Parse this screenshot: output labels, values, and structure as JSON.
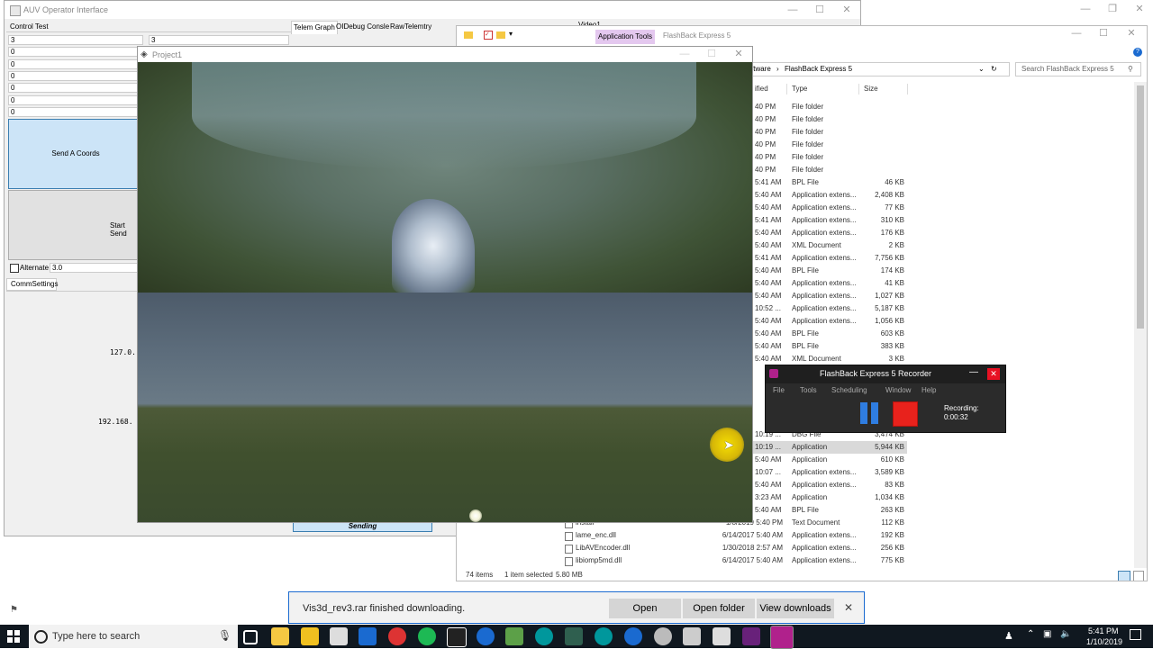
{
  "auv": {
    "title": "AUV Operator Interface",
    "control_test_label": "Control Test",
    "fields": [
      "3",
      "0",
      "0",
      "0",
      "0",
      "0",
      "0",
      "0"
    ],
    "field_right": "3",
    "send_coords_label": "Send A Coords",
    "start_send_label": "Start Send",
    "alternate_label": "Alternate",
    "alternate_value": "3.0",
    "comm_tab": "CommSettings",
    "ip1": "127.0.",
    "ip2": "192.168.",
    "tabs": [
      "Telem Graph",
      "OIDebug Consle",
      "RawTelemtry"
    ],
    "video_tab": "Video1",
    "sending_label": "Sending"
  },
  "project": {
    "title": "Project1"
  },
  "explorer": {
    "ribbon_context": "Application Tools",
    "title": "FlashBack Express 5",
    "path_prefix": "ftware",
    "path_current": "FlashBack Express 5",
    "search_placeholder": "Search FlashBack Express 5",
    "headers": {
      "modified": "ified",
      "type": "Type",
      "size": "Size"
    },
    "rows": [
      {
        "m": "40 PM",
        "t": "File folder",
        "s": ""
      },
      {
        "m": "40 PM",
        "t": "File folder",
        "s": ""
      },
      {
        "m": "40 PM",
        "t": "File folder",
        "s": ""
      },
      {
        "m": "40 PM",
        "t": "File folder",
        "s": ""
      },
      {
        "m": "40 PM",
        "t": "File folder",
        "s": ""
      },
      {
        "m": "40 PM",
        "t": "File folder",
        "s": ""
      },
      {
        "m": "5:41 AM",
        "t": "BPL File",
        "s": "46 KB"
      },
      {
        "m": "5:40 AM",
        "t": "Application extens...",
        "s": "2,408 KB"
      },
      {
        "m": "5:40 AM",
        "t": "Application extens...",
        "s": "77 KB"
      },
      {
        "m": "5:41 AM",
        "t": "Application extens...",
        "s": "310 KB"
      },
      {
        "m": "5:40 AM",
        "t": "Application extens...",
        "s": "176 KB"
      },
      {
        "m": "5:40 AM",
        "t": "XML Document",
        "s": "2 KB"
      },
      {
        "m": "5:41 AM",
        "t": "Application extens...",
        "s": "7,756 KB"
      },
      {
        "m": "5:40 AM",
        "t": "BPL File",
        "s": "174 KB"
      },
      {
        "m": "5:40 AM",
        "t": "Application extens...",
        "s": "41 KB"
      },
      {
        "m": "5:40 AM",
        "t": "Application extens...",
        "s": "1,027 KB"
      },
      {
        "m": "10:52 ...",
        "t": "Application extens...",
        "s": "5,187 KB"
      },
      {
        "m": "5:40 AM",
        "t": "Application extens...",
        "s": "1,056 KB"
      },
      {
        "m": "5:40 AM",
        "t": "BPL File",
        "s": "603 KB"
      },
      {
        "m": "5:40 AM",
        "t": "BPL File",
        "s": "383 KB"
      },
      {
        "m": "5:40 AM",
        "t": "XML Document",
        "s": "3 KB"
      }
    ],
    "lower_rows": [
      {
        "n": "",
        "m": "10:19 ...",
        "t": "DBG File",
        "s": "3,474 KB",
        "sel": false
      },
      {
        "n": "",
        "m": "10:19 ...",
        "t": "Application",
        "s": "5,944 KB",
        "sel": true
      },
      {
        "n": "",
        "m": "5:40 AM",
        "t": "Application",
        "s": "610 KB",
        "sel": false
      },
      {
        "n": "",
        "m": "10:07 ...",
        "t": "Application extens...",
        "s": "3,589 KB",
        "sel": false
      },
      {
        "n": "",
        "m": "5:40 AM",
        "t": "Application extens...",
        "s": "83 KB",
        "sel": false
      },
      {
        "n": "",
        "m": "3:23 AM",
        "t": "Application",
        "s": "1,034 KB",
        "sel": false
      },
      {
        "n": "",
        "m": "5:40 AM",
        "t": "BPL File",
        "s": "263 KB",
        "sel": false
      },
      {
        "n": "install",
        "m": "1/8/2019 5:40 PM",
        "t": "Text Document",
        "s": "112 KB",
        "sel": false
      },
      {
        "n": "lame_enc.dll",
        "m": "6/14/2017 5:40 AM",
        "t": "Application extens...",
        "s": "192 KB",
        "sel": false
      },
      {
        "n": "LibAVEncoder.dll",
        "m": "1/30/2018 2:57 AM",
        "t": "Application extens...",
        "s": "256 KB",
        "sel": false
      },
      {
        "n": "libiomp5md.dll",
        "m": "6/14/2017 5:40 AM",
        "t": "Application extens...",
        "s": "775 KB",
        "sel": false
      }
    ],
    "status": {
      "items": "74 items",
      "selected": "1 item selected",
      "size": "5.80 MB"
    }
  },
  "recorder": {
    "title": "FlashBack Express 5 Recorder",
    "menu": [
      "File",
      "Tools",
      "Scheduling",
      "Window",
      "Help"
    ],
    "recording_label": "Recording:",
    "recording_time": "0:00:32"
  },
  "download": {
    "message": "Vis3d_rev3.rar finished downloading.",
    "open_label": "Open",
    "open_folder_label": "Open folder",
    "view_downloads_label": "View downloads"
  },
  "taskbar": {
    "search_placeholder": "Type here to search",
    "time": "5:41 PM",
    "date": "1/10/2019"
  },
  "colors": {
    "record_red": "#e8221c",
    "pause_blue": "#2f7de1",
    "taskbar": "#101820",
    "recorder_bg": "#2b2b2b"
  }
}
